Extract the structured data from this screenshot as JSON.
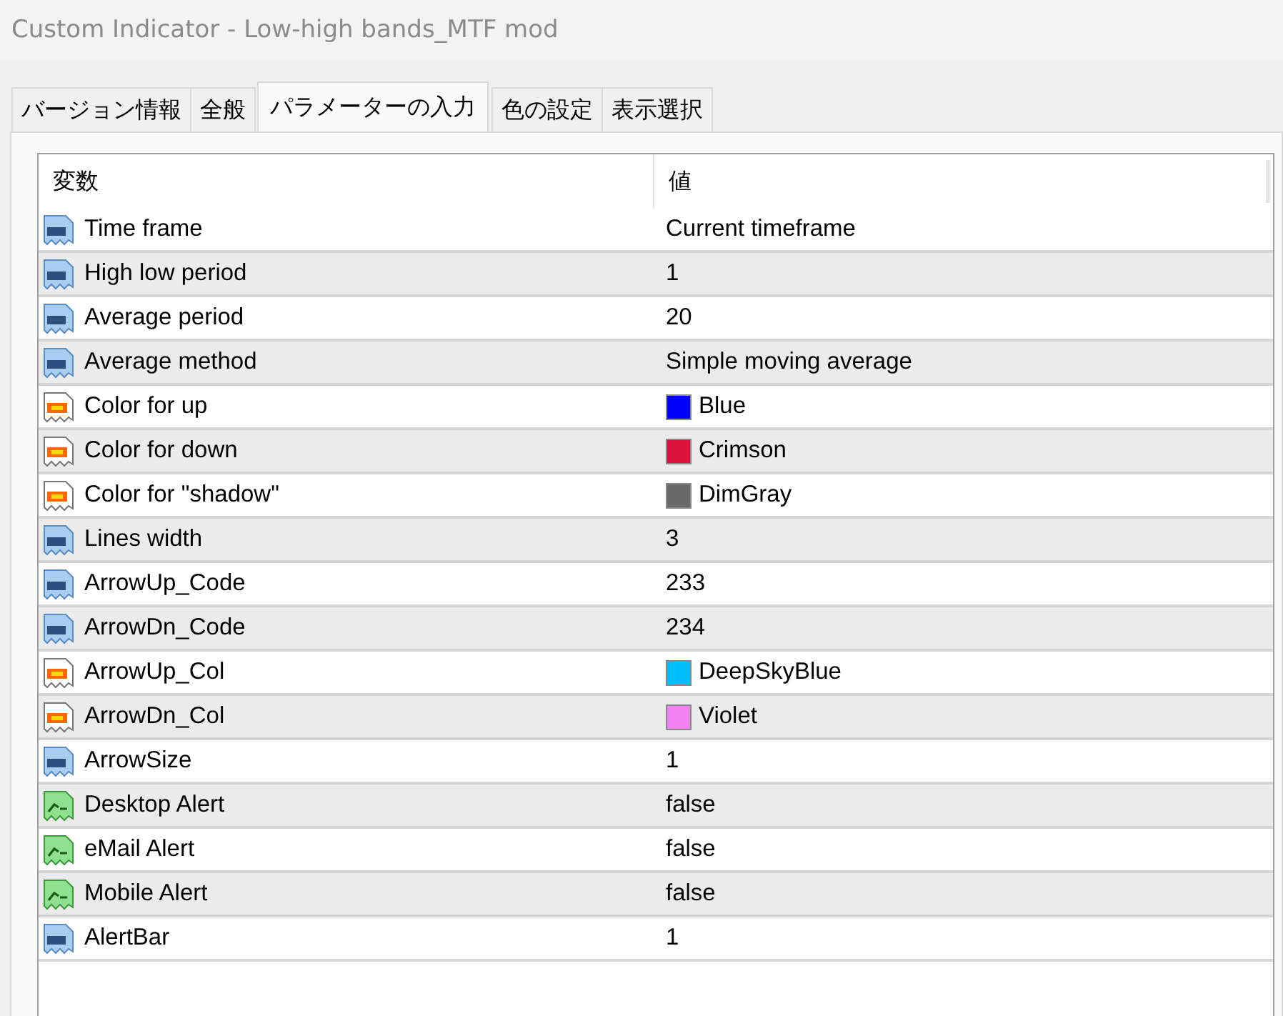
{
  "window": {
    "title": "Custom Indicator - Low-high bands_MTF mod"
  },
  "tabs": [
    {
      "label": "バージョン情報",
      "selected": false
    },
    {
      "label": "全般",
      "selected": false
    },
    {
      "label": "パラメーターの入力",
      "selected": true
    },
    {
      "label": "色の設定",
      "selected": false
    },
    {
      "label": "表示選択",
      "selected": false
    }
  ],
  "table": {
    "columns": [
      "変数",
      "値"
    ],
    "rows": [
      {
        "kind": "number",
        "name": "Time frame",
        "value": "Current timeframe"
      },
      {
        "kind": "number",
        "name": "High low period",
        "value": "1"
      },
      {
        "kind": "number",
        "name": "Average period",
        "value": "20"
      },
      {
        "kind": "number",
        "name": "Average method",
        "value": "Simple moving average"
      },
      {
        "kind": "color",
        "name": "Color for up",
        "value": "Blue",
        "color": "#0000ff"
      },
      {
        "kind": "color",
        "name": "Color for down",
        "value": "Crimson",
        "color": "#dc143c"
      },
      {
        "kind": "color",
        "name": "Color for \"shadow\"",
        "value": "DimGray",
        "color": "#696969"
      },
      {
        "kind": "number",
        "name": "Lines width",
        "value": "3"
      },
      {
        "kind": "number",
        "name": "ArrowUp_Code",
        "value": "233"
      },
      {
        "kind": "number",
        "name": "ArrowDn_Code",
        "value": "234"
      },
      {
        "kind": "color",
        "name": "ArrowUp_Col",
        "value": "DeepSkyBlue",
        "color": "#00bfff"
      },
      {
        "kind": "color",
        "name": "ArrowDn_Col",
        "value": "Violet",
        "color": "#ee82ee"
      },
      {
        "kind": "number",
        "name": "ArrowSize",
        "value": "1"
      },
      {
        "kind": "bool",
        "name": "Desktop Alert",
        "value": "false"
      },
      {
        "kind": "bool",
        "name": "eMail Alert",
        "value": "false"
      },
      {
        "kind": "bool",
        "name": "Mobile Alert",
        "value": "false"
      },
      {
        "kind": "number",
        "name": "AlertBar",
        "value": "1"
      }
    ]
  }
}
